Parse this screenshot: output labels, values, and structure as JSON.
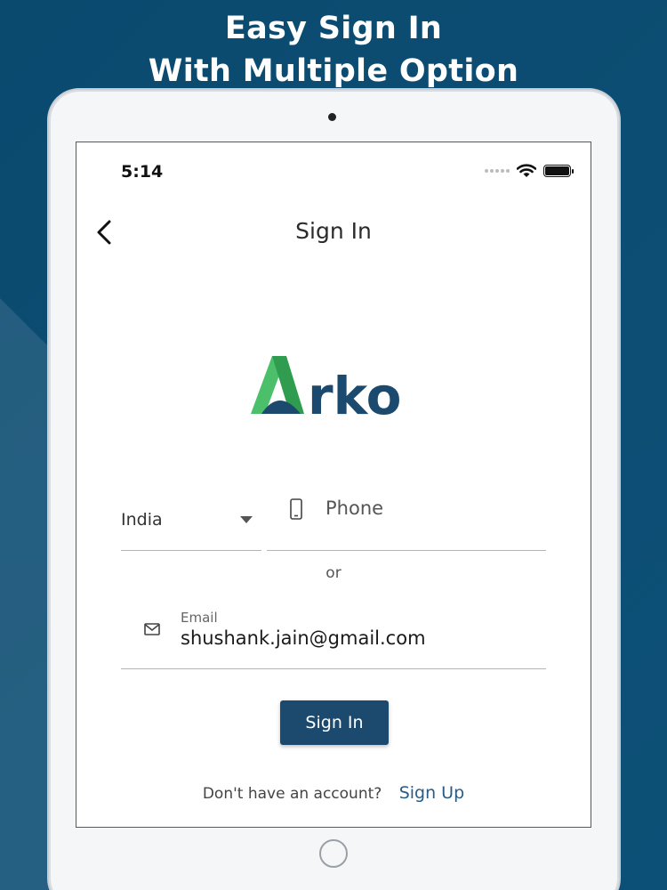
{
  "promo": {
    "headline_line1": "Easy Sign In",
    "headline_line2": "With Multiple Option"
  },
  "status_bar": {
    "time": "5:14"
  },
  "nav": {
    "title": "Sign In"
  },
  "logo": {
    "text": "Arko",
    "colors": {
      "green": "#4cbf6a",
      "navy": "#1c4a6e"
    }
  },
  "form": {
    "country": "India",
    "phone_placeholder": "Phone",
    "separator": "or",
    "email_label": "Email",
    "email_value": "shushank.jain@gmail.com",
    "submit_label": "Sign In"
  },
  "footer": {
    "prompt": "Don't have an account?",
    "signup_link": "Sign Up"
  },
  "colors": {
    "background": "#0b4a6f",
    "button": "#1c4a6e",
    "link": "#2a5b86"
  },
  "icons": [
    "back-chevron-icon",
    "wifi-icon",
    "battery-icon",
    "dropdown-caret-icon",
    "phone-icon",
    "mail-icon"
  ]
}
